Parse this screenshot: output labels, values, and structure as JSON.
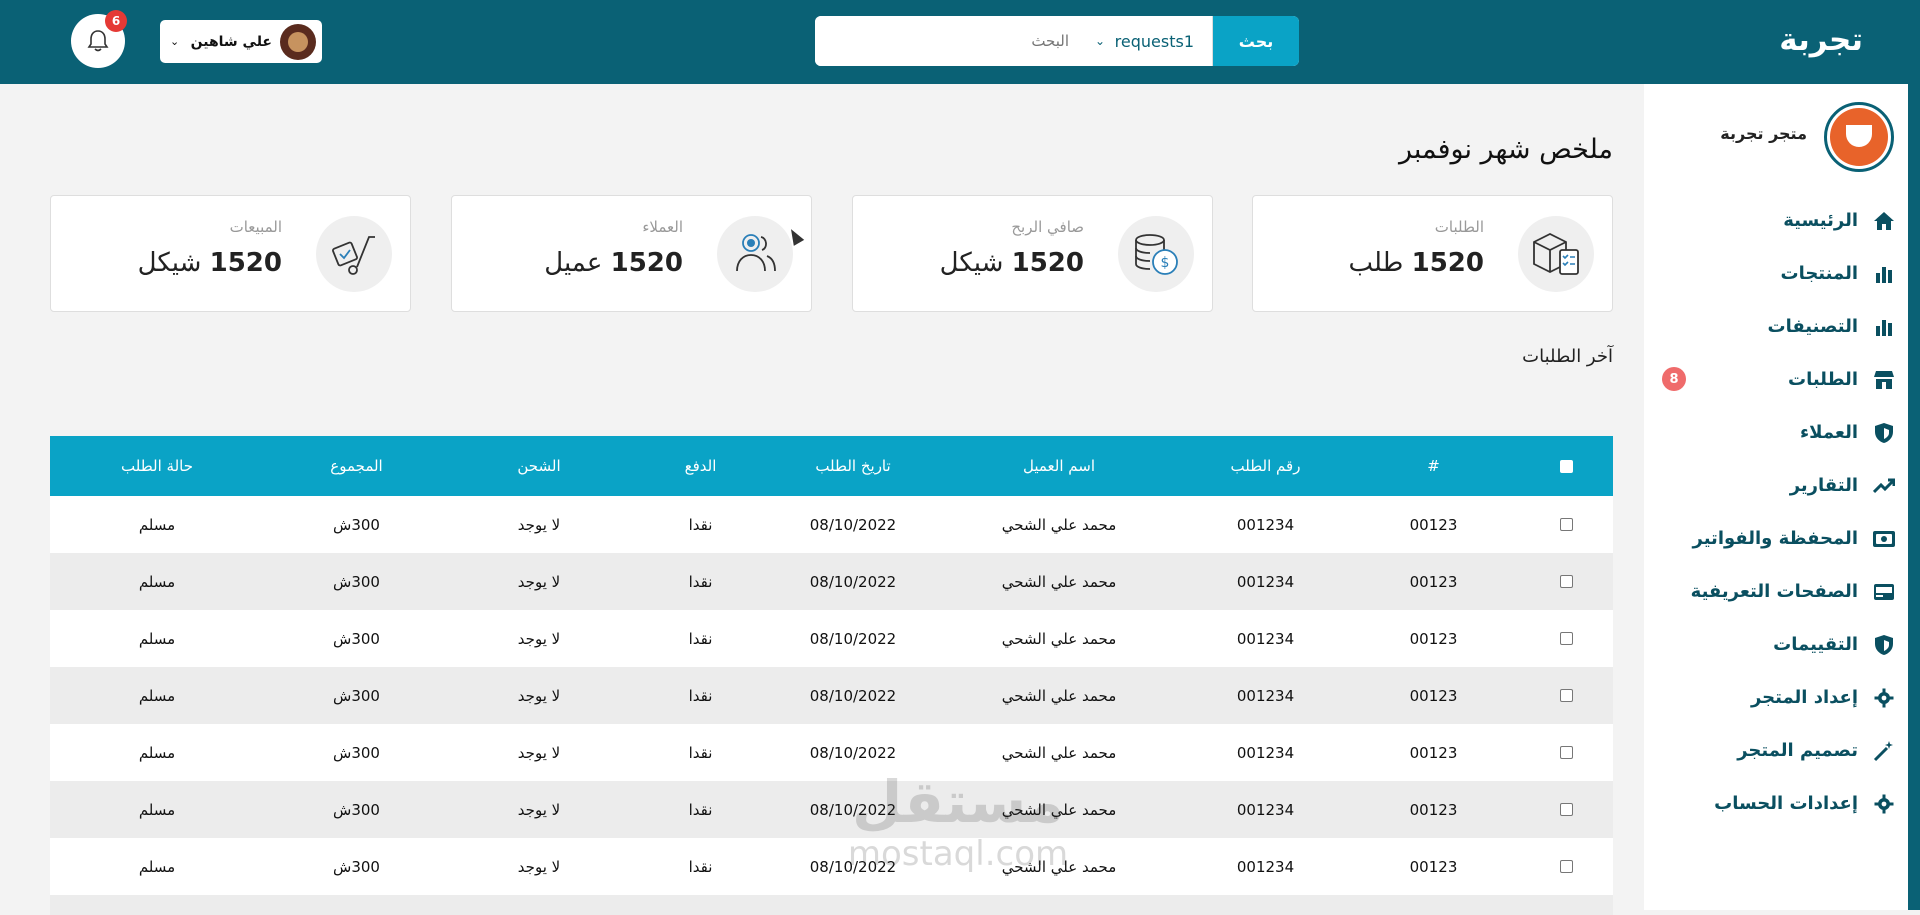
{
  "brand": "تجربة",
  "search": {
    "placeholder": "البحث",
    "scope": "requests1",
    "button": "بحث"
  },
  "user": {
    "name": "علي شاهين"
  },
  "notifications": {
    "count": "6"
  },
  "store": {
    "name": "متجر تجربة"
  },
  "sidebar": {
    "items": [
      {
        "label": "الرئيسية",
        "icon": "home-icon"
      },
      {
        "label": "المنتجات",
        "icon": "bar-chart-icon"
      },
      {
        "label": "التصنيفات",
        "icon": "bar-chart-icon"
      },
      {
        "label": "الطلبات",
        "icon": "store-icon",
        "badge": "8"
      },
      {
        "label": "العملاء",
        "icon": "shield-icon"
      },
      {
        "label": "التقارير",
        "icon": "trend-icon"
      },
      {
        "label": "المحفظة والفواتير",
        "icon": "wallet-icon"
      },
      {
        "label": "الصفحات التعريفية",
        "icon": "card-icon"
      },
      {
        "label": "التقييمات",
        "icon": "shield-icon"
      },
      {
        "label": "إعداد المتجر",
        "icon": "gear-icon"
      },
      {
        "label": "تصميم المتجر",
        "icon": "magic-wand-icon"
      },
      {
        "label": "إعدادات الحساب",
        "icon": "gear-icon"
      }
    ]
  },
  "summary": {
    "title": "ملخص شهر نوفمبر",
    "cards": [
      {
        "label": "الطلبات",
        "value": "1520",
        "unit": "طلب",
        "icon": "box-checklist-icon"
      },
      {
        "label": "صافي الربح",
        "value": "1520",
        "unit": "شيكل",
        "icon": "coins-icon"
      },
      {
        "label": "العملاء",
        "value": "1520",
        "unit": "عميل",
        "icon": "users-icon"
      },
      {
        "label": "المبيعات",
        "value": "1520",
        "unit": "شيكل",
        "icon": "hand-truck-icon"
      }
    ]
  },
  "recent": {
    "title": "آخر الطلبات",
    "headers": [
      "#",
      "رقم الطلب",
      "اسم العميل",
      "تاريخ الطلب",
      "الدفع",
      "الشحن",
      "المجموع",
      "حالة الطلب"
    ],
    "rows": [
      [
        "00123",
        "001234",
        "محمد علي الشحي",
        "08/10/2022",
        "نقدا",
        "لا يوجد",
        "300ش",
        "مسلم"
      ],
      [
        "00123",
        "001234",
        "محمد علي الشحي",
        "08/10/2022",
        "نقدا",
        "لا يوجد",
        "300ش",
        "مسلم"
      ],
      [
        "00123",
        "001234",
        "محمد علي الشحي",
        "08/10/2022",
        "نقدا",
        "لا يوجد",
        "300ش",
        "مسلم"
      ],
      [
        "00123",
        "001234",
        "محمد علي الشحي",
        "08/10/2022",
        "نقدا",
        "لا يوجد",
        "300ش",
        "مسلم"
      ],
      [
        "00123",
        "001234",
        "محمد علي الشحي",
        "08/10/2022",
        "نقدا",
        "لا يوجد",
        "300ش",
        "مسلم"
      ],
      [
        "00123",
        "001234",
        "محمد علي الشحي",
        "08/10/2022",
        "نقدا",
        "لا يوجد",
        "300ش",
        "مسلم"
      ],
      [
        "00123",
        "001234",
        "محمد علي الشحي",
        "08/10/2022",
        "نقدا",
        "لا يوجد",
        "300ش",
        "مسلم"
      ]
    ]
  },
  "watermark": {
    "arabic": "مستقل",
    "latin": "mostaql.com"
  },
  "colors": {
    "header": "#0a6175",
    "accent": "#0aa3c6",
    "badge": "#e53935"
  }
}
